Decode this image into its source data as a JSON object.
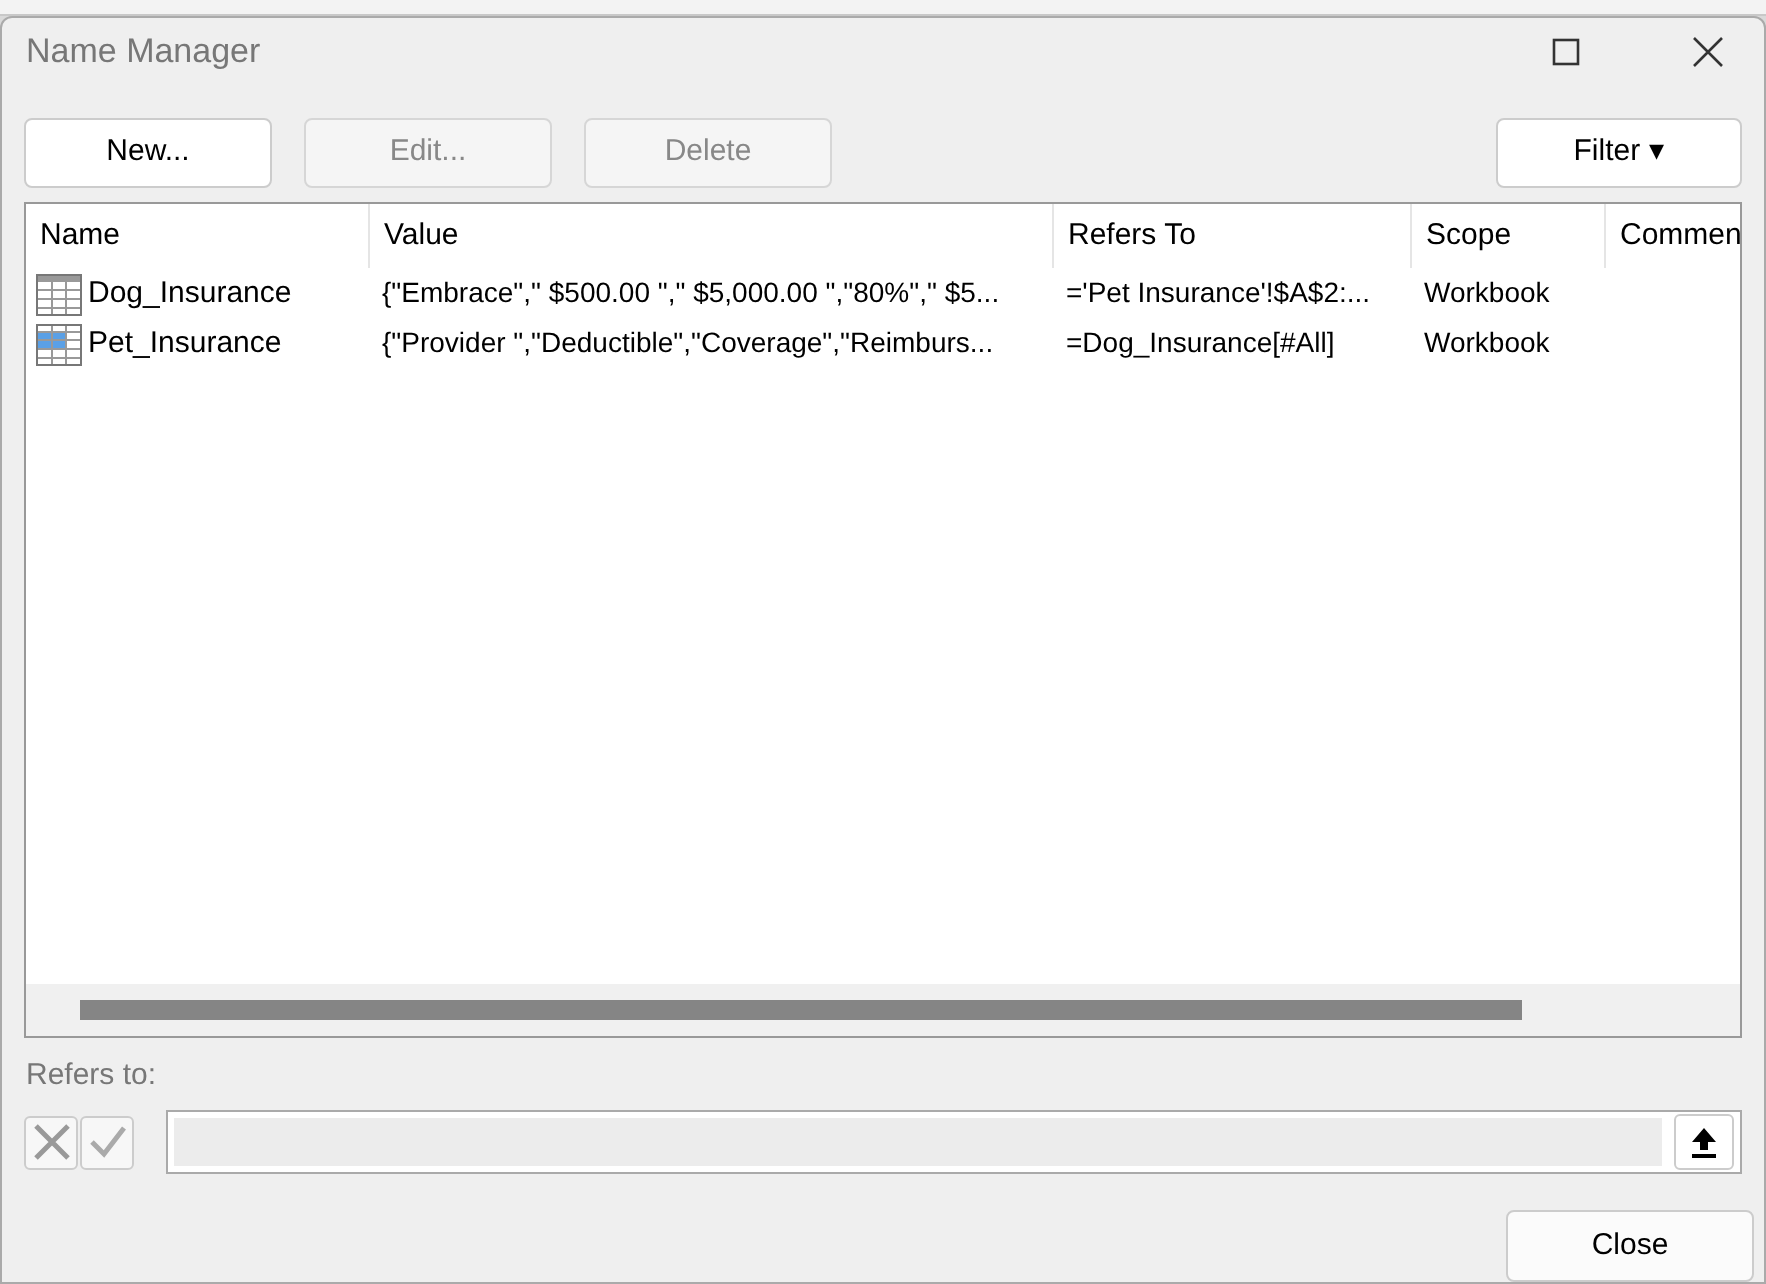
{
  "window": {
    "title": "Name Manager"
  },
  "toolbar": [
    {
      "label": "New...",
      "disabled": false
    },
    {
      "label": "Edit...",
      "disabled": true
    },
    {
      "label": "Delete",
      "disabled": true
    }
  ],
  "filter_button": {
    "label": "Filter",
    "caret": "▾"
  },
  "table": {
    "columns": [
      "Name",
      "Value",
      "Refers To",
      "Scope",
      "Commen"
    ],
    "rows": [
      {
        "kind": "table",
        "name": "Dog_Insurance",
        "value": "{\"Embrace\",\" $500.00 \",\" $5,000.00 \",\"80%\",\" $5...",
        "refers_to": "='Pet Insurance'!$A$2:...",
        "scope": "Workbook",
        "selected": false
      },
      {
        "kind": "range",
        "name": "Pet_Insurance",
        "value": "{\"Provider \",\"Deductible\",\"Coverage\",\"Reimburs...",
        "refers_to": "=Dog_Insurance[#All]",
        "scope": "Workbook",
        "selected": false
      }
    ]
  },
  "refers_to": {
    "label": "Refers to:"
  },
  "close_button": {
    "label": "Close"
  }
}
